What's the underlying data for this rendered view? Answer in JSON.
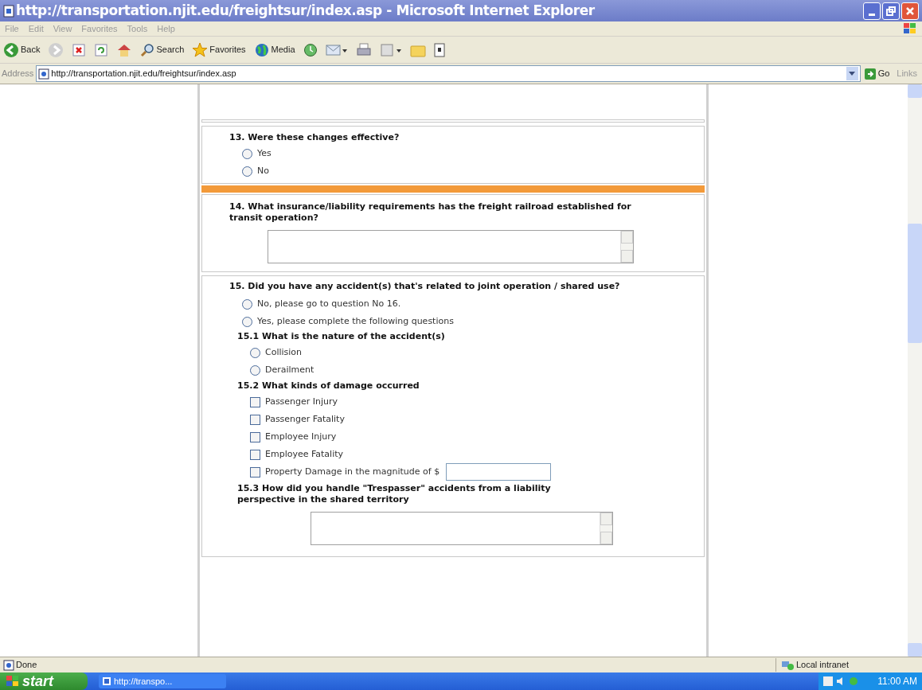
{
  "window": {
    "title": "http://transportation.njit.edu/freightsur/index.asp - Microsoft Internet Explorer"
  },
  "menu": [
    "File",
    "Edit",
    "View",
    "Favorites",
    "Tools",
    "Help"
  ],
  "toolbar": [
    {
      "kind": "back",
      "label": "Back"
    },
    {
      "kind": "forward"
    },
    {
      "kind": "stop"
    },
    {
      "kind": "refresh"
    },
    {
      "kind": "home"
    },
    {
      "kind": "search",
      "label": "Search"
    },
    {
      "kind": "favorites",
      "label": "Favorites"
    },
    {
      "kind": "media",
      "label": "Media"
    },
    {
      "kind": "history"
    },
    {
      "kind": "mail"
    },
    {
      "kind": "print"
    },
    {
      "kind": "edit"
    },
    {
      "kind": "discuss"
    },
    {
      "kind": "messenger"
    }
  ],
  "address": {
    "label": "Address",
    "value": "http://transportation.njit.edu/freightsur/index.asp",
    "go": "Go",
    "links": "Links"
  },
  "questions": [
    {
      "kind": "radio",
      "title": "13. Were these changes effective?",
      "options": [
        {
          "label": "Yes",
          "selected": false
        },
        {
          "label": "No",
          "selected": false
        }
      ]
    },
    {
      "kind": "separator"
    },
    {
      "kind": "text",
      "title": "14. What insurance/liability requirements has the freight railroad established for transit operation?"
    },
    {
      "kind": "group",
      "title": "15. Did you have any accident(s) that's related to joint operation / shared use?",
      "options": [
        {
          "label": "No, please go to question No 16.",
          "selected": false
        },
        {
          "label": "Yes, please complete the following questions",
          "selected": false
        }
      ],
      "parts": [
        {
          "kind": "radio",
          "title": "15.1 What is the nature of the accident(s)",
          "options": [
            {
              "label": "Collision",
              "selected": false
            },
            {
              "label": "Derailment",
              "selected": false
            }
          ]
        },
        {
          "kind": "checkbox",
          "title": "15.2 What kinds of damage occurred",
          "options": [
            {
              "label": "Passenger Injury",
              "checked": false
            },
            {
              "label": "Passenger Fatality",
              "checked": false
            },
            {
              "label": "Employee Injury",
              "checked": false
            },
            {
              "label": "Employee Fatality",
              "checked": false
            },
            {
              "label": "Property Damage in the magnitude of $",
              "checked": false,
              "field": true
            }
          ]
        },
        {
          "kind": "text",
          "title": "15.3 How did you handle \"Trespasser\" accidents from a liability  perspective in the shared territory"
        }
      ]
    }
  ],
  "status": {
    "text": "Done",
    "zone": "Local intranet"
  },
  "taskbar": {
    "start": "start",
    "task": "http://transpo...",
    "clock": "11:00 AM"
  }
}
